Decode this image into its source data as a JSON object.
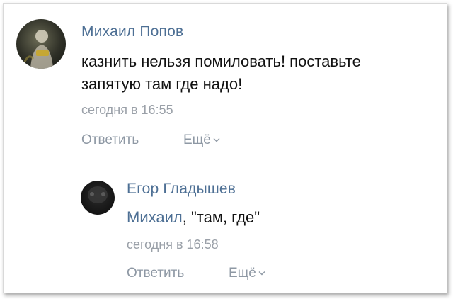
{
  "comments": [
    {
      "author": "Михаил Попов",
      "text_line1": "казнить нельзя помиловать! поставьте",
      "text_line2": "запятую там где надо!",
      "time": "сегодня в 16:55",
      "reply_label": "Ответить",
      "more_label": "Ещё"
    },
    {
      "author": "Егор Гладышев",
      "mention": "Михаил",
      "text": ", \"там, где\"",
      "time": "сегодня в 16:58",
      "reply_label": "Ответить",
      "more_label": "Ещё"
    }
  ],
  "colors": {
    "author": "#4d6f94",
    "text": "#111111",
    "meta": "#9aa0a8",
    "action": "#8e98a4"
  }
}
